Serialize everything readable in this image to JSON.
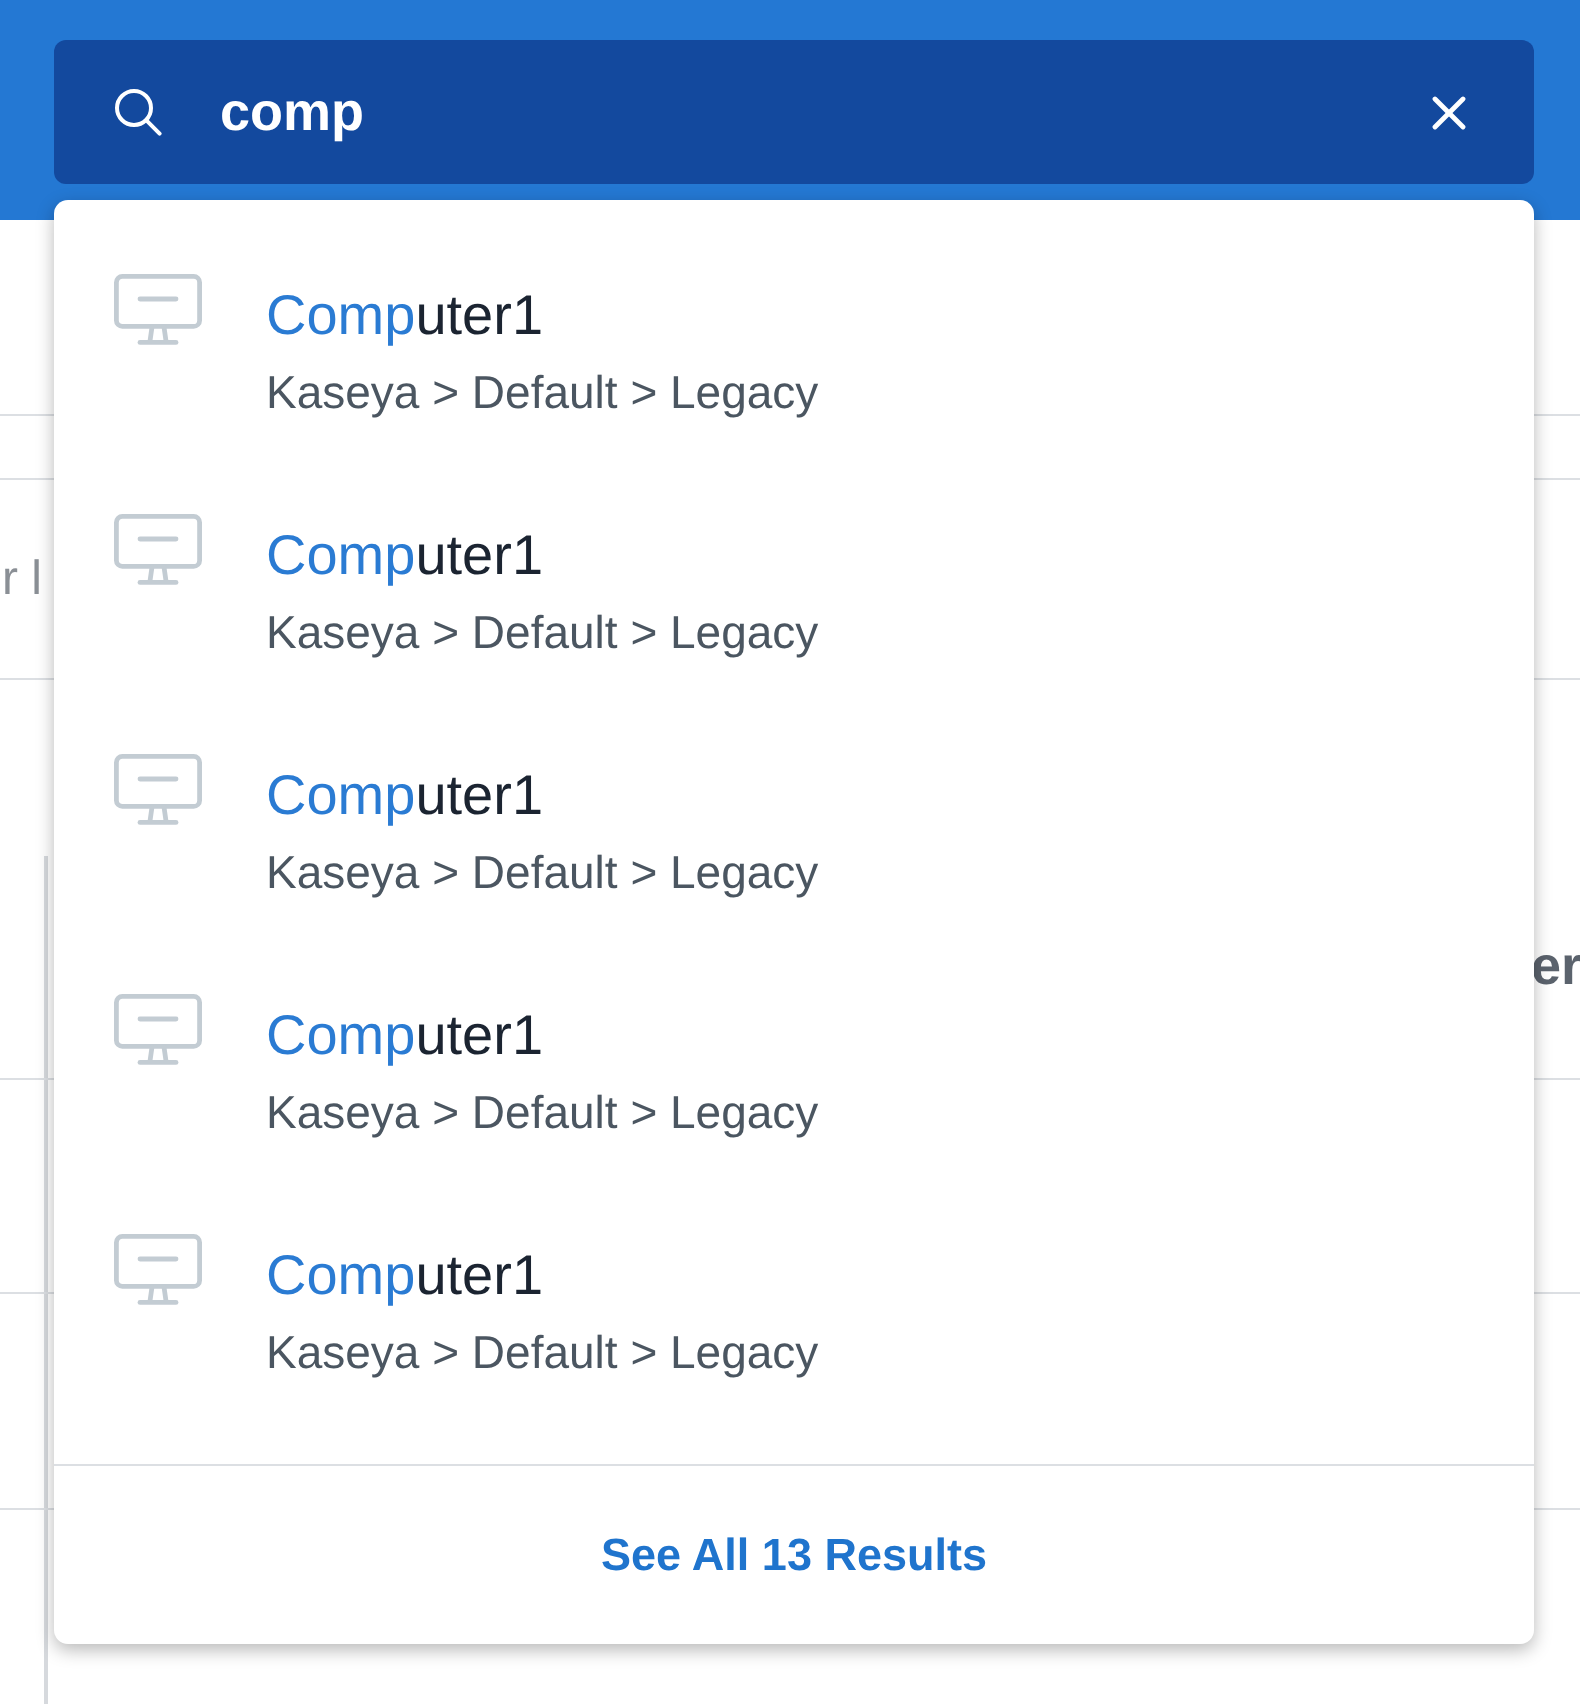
{
  "header": {
    "search": {
      "value": "comp"
    }
  },
  "results": [
    {
      "title": "**Comp**uter1",
      "path": "Kaseya > Default > Legacy"
    },
    {
      "title": "**Comp**uter1",
      "path": "Kaseya > Default > Legacy"
    },
    {
      "title": "**Comp**uter1",
      "path": "Kaseya > Default > Legacy"
    },
    {
      "title": "**Comp**uter1",
      "path": "Kaseya > Default > Legacy"
    },
    {
      "title": "**Comp**uter1",
      "path": "Kaseya > Default > Legacy"
    }
  ],
  "footer": {
    "see_all_link": "See All 13 Results"
  },
  "background_page": {
    "left_cell_fragment": "r l",
    "right_header_fragment": "er"
  }
}
